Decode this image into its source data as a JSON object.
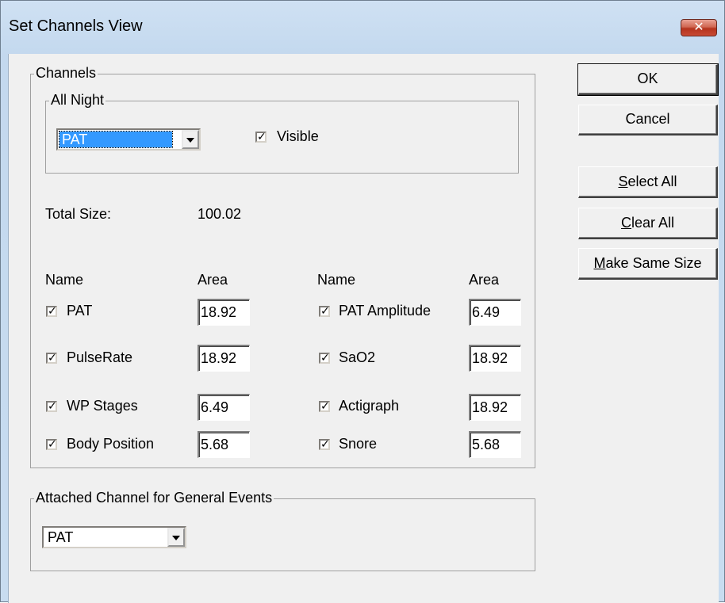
{
  "window": {
    "title": "Set Channels View",
    "close_label": "✕"
  },
  "channels": {
    "group_label": "Channels",
    "all_night": {
      "group_label": "All Night",
      "selected": "PAT",
      "visible_label": "Visible",
      "visible_checked": true
    },
    "total_size_label": "Total Size:",
    "total_size_value": "100.02",
    "columns": {
      "name_header": "Name",
      "area_header": "Area"
    },
    "left": [
      {
        "name": "PAT",
        "area": "18.92",
        "checked": true
      },
      {
        "name": "PulseRate",
        "area": "18.92",
        "checked": true
      },
      {
        "name": "WP Stages",
        "area": "6.49",
        "checked": true
      },
      {
        "name": "Body Position",
        "area": "5.68",
        "checked": true
      }
    ],
    "right": [
      {
        "name": "PAT Amplitude",
        "area": "6.49",
        "checked": true
      },
      {
        "name": "SaO2",
        "area": "18.92",
        "checked": true
      },
      {
        "name": "Actigraph",
        "area": "18.92",
        "checked": true
      },
      {
        "name": "Snore",
        "area": "5.68",
        "checked": true
      }
    ]
  },
  "attached": {
    "group_label": "Attached Channel for General Events",
    "selected": "PAT"
  },
  "buttons": {
    "ok": "OK",
    "cancel": "Cancel",
    "select_all_mnemonic": "S",
    "select_all_rest": "elect All",
    "clear_all_mnemonic": "C",
    "clear_all_rest": "lear All",
    "make_same_size_mnemonic": "M",
    "make_same_size_rest": "ake Same Size"
  },
  "colors": {
    "selection": "#3399ff",
    "close_button": "#c84a34",
    "dialog_face": "#f0f0f0"
  }
}
